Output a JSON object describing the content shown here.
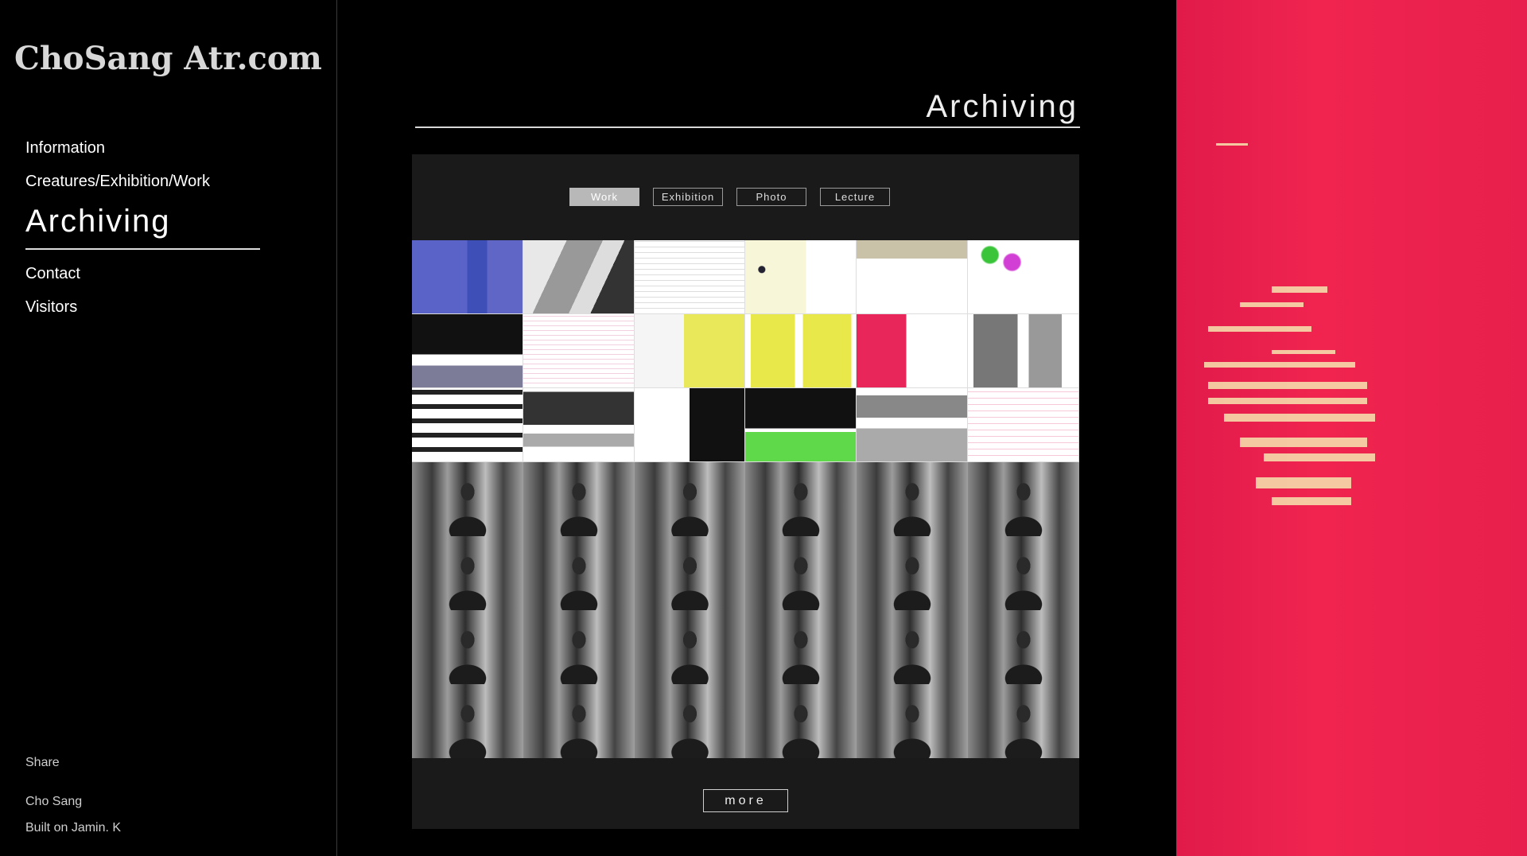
{
  "site": {
    "logo": "ChoSang Atr.com"
  },
  "nav": {
    "items": [
      {
        "label": "Information",
        "active": false
      },
      {
        "label": "Creatures/Exhibition/Work",
        "active": false
      },
      {
        "label": "Archiving",
        "active": true
      },
      {
        "label": "Contact",
        "active": false
      },
      {
        "label": "Visitors",
        "active": false
      }
    ]
  },
  "footer": {
    "share": "Share",
    "author": "Cho Sang",
    "built": "Built on Jamin. K"
  },
  "main": {
    "title": "Archiving",
    "tabs": [
      {
        "label": "Work",
        "active": true
      },
      {
        "label": "Exhibition",
        "active": false
      },
      {
        "label": "Photo",
        "active": false
      },
      {
        "label": "Lecture",
        "active": false
      }
    ],
    "more_label": "more"
  },
  "colors": {
    "background": "#000000",
    "panel": "#1a1a1a",
    "accent_art": "#e81f4c"
  }
}
